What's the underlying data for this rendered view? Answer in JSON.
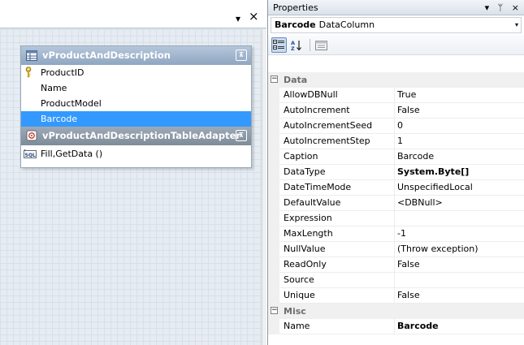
{
  "designer": {
    "controls": {
      "dropdown_glyph": "▾",
      "close_glyph": "×"
    },
    "table": {
      "title": "vProductAndDescription",
      "collapse_glyph": "⊼",
      "columns": [
        {
          "label": "ProductID",
          "is_key": true,
          "selected": false
        },
        {
          "label": "Name",
          "is_key": false,
          "selected": false
        },
        {
          "label": "ProductModel",
          "is_key": false,
          "selected": false
        },
        {
          "label": "Barcode",
          "is_key": false,
          "selected": true
        }
      ],
      "key_icon": "key-icon"
    },
    "adapter": {
      "title": "vProductAndDescriptionTableAdapter",
      "collapse_glyph": "⊼",
      "methods": [
        "Fill,GetData ()"
      ],
      "method_icon": "sql-icon"
    }
  },
  "properties": {
    "title": "Properties",
    "title_controls": [
      "▾",
      "ᛘ",
      "×"
    ],
    "object": {
      "name": "Barcode",
      "type": "DataColumn",
      "dropdown_glyph": "▾"
    },
    "toolbar": {
      "categorized_icon": "categorized-icon",
      "alphabetical_icon": "alphabetical-icon",
      "property_pages_icon": "property-pages-icon",
      "active": "categorized"
    },
    "categories": [
      {
        "name": "Data",
        "expanded": true,
        "toggle": "⊟",
        "properties": [
          {
            "name": "AllowDBNull",
            "value": "True",
            "bold": false
          },
          {
            "name": "AutoIncrement",
            "value": "False",
            "bold": false
          },
          {
            "name": "AutoIncrementSeed",
            "value": "0",
            "bold": false
          },
          {
            "name": "AutoIncrementStep",
            "value": "1",
            "bold": false
          },
          {
            "name": "Caption",
            "value": "Barcode",
            "bold": false
          },
          {
            "name": "DataType",
            "value": "System.Byte[]",
            "bold": true
          },
          {
            "name": "DateTimeMode",
            "value": "UnspecifiedLocal",
            "bold": false
          },
          {
            "name": "DefaultValue",
            "value": "<DBNull>",
            "bold": false
          },
          {
            "name": "Expression",
            "value": "",
            "bold": false
          },
          {
            "name": "MaxLength",
            "value": "-1",
            "bold": false
          },
          {
            "name": "NullValue",
            "value": "(Throw exception)",
            "bold": false
          },
          {
            "name": "ReadOnly",
            "value": "False",
            "bold": false
          },
          {
            "name": "Source",
            "value": "",
            "bold": false
          },
          {
            "name": "Unique",
            "value": "False",
            "bold": false
          }
        ]
      },
      {
        "name": "Misc",
        "expanded": true,
        "toggle": "⊟",
        "properties": [
          {
            "name": "Name",
            "value": "Barcode",
            "bold": true
          }
        ]
      }
    ]
  },
  "colors": {
    "selection": "#3399ff",
    "table_header": "#8fa6c1",
    "adapter_header": "#7e8b98"
  }
}
